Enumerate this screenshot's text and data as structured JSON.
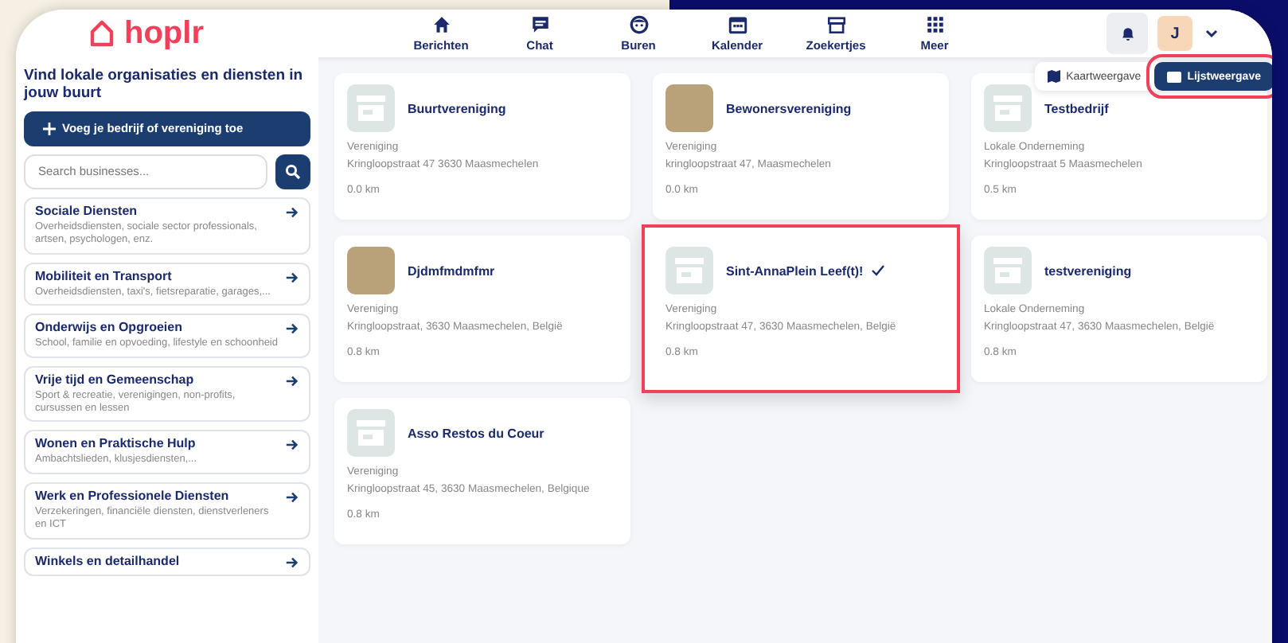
{
  "header": {
    "logo": "hoplr",
    "nav": [
      {
        "label": "Berichten"
      },
      {
        "label": "Chat"
      },
      {
        "label": "Buren"
      },
      {
        "label": "Kalender"
      },
      {
        "label": "Zoekertjes"
      },
      {
        "label": "Meer"
      }
    ],
    "avatar": "J"
  },
  "sidebar": {
    "title": "Vind lokale organisaties en diensten in jouw buurt",
    "add_button": "Voeg je bedrijf of vereniging toe",
    "search": {
      "placeholder": "Search businesses..."
    },
    "categories": [
      {
        "title": "Sociale Diensten",
        "description": "Overheidsdiensten, sociale sector professionals, artsen, psychologen, enz."
      },
      {
        "title": "Mobiliteit en Transport",
        "description": "Overheidsdiensten, taxi's, fietsreparatie, garages,..."
      },
      {
        "title": "Onderwijs en Opgroeien",
        "description": "School, familie en opvoeding, lifestyle en schoonheid"
      },
      {
        "title": "Vrije tijd en Gemeenschap",
        "description": "Sport & recreatie, verenigingen, non-profits, cursussen en lessen"
      },
      {
        "title": "Wonen en Praktische Hulp",
        "description": "Ambachtslieden, klusjesdiensten,..."
      },
      {
        "title": "Werk en Professionele Diensten",
        "description": "Verzekeringen, financiële diensten, dienstverleners en ICT"
      },
      {
        "title": "Winkels en detailhandel"
      }
    ]
  },
  "view_toggle": [
    {
      "label": "Kaartweergave",
      "selected": false,
      "highlighted": false
    },
    {
      "label": "Lijstweergave",
      "selected": true,
      "highlighted": true
    }
  ],
  "results": [
    {
      "name": "Buurtvereniging",
      "kind": "store",
      "type": "Vereniging",
      "address": "Kringloopstraat 47 3630 Maasmechelen",
      "distance": "0.0 km",
      "verified": false,
      "highlighted": false
    },
    {
      "name": "Bewonersvereniging",
      "kind": "photo",
      "type": "Vereniging",
      "address": "kringloopstraat 47, Maasmechelen",
      "distance": "0.0 km",
      "verified": false,
      "highlighted": false
    },
    {
      "name": "Testbedrijf",
      "kind": "store",
      "type": "Lokale Onderneming",
      "address": "Kringloopstraat 5 Maasmechelen",
      "distance": "0.5 km",
      "verified": false,
      "highlighted": false
    },
    {
      "name": "Djdmfmdmfmr",
      "kind": "photo",
      "type": "Vereniging",
      "address": "Kringloopstraat, 3630 Maasmechelen, België",
      "distance": "0.8 km",
      "verified": false,
      "highlighted": false
    },
    {
      "name": "Sint-AnnaPlein Leef(t)!",
      "kind": "store",
      "type": "Vereniging",
      "address": "Kringloopstraat 47, 3630 Maasmechelen, België",
      "distance": "0.8 km",
      "verified": true,
      "highlighted": true
    },
    {
      "name": "testvereniging",
      "kind": "store",
      "type": "Lokale Onderneming",
      "address": "Kringloopstraat 47, 3630 Maasmechelen, België",
      "distance": "0.8 km",
      "verified": false,
      "highlighted": false
    },
    {
      "name": "Asso Restos du Coeur",
      "kind": "store",
      "type": "Vereniging",
      "address": "Kringloopstraat 45, 3630 Maasmechelen, Belgique",
      "distance": "0.8 km",
      "verified": false,
      "highlighted": false
    }
  ]
}
